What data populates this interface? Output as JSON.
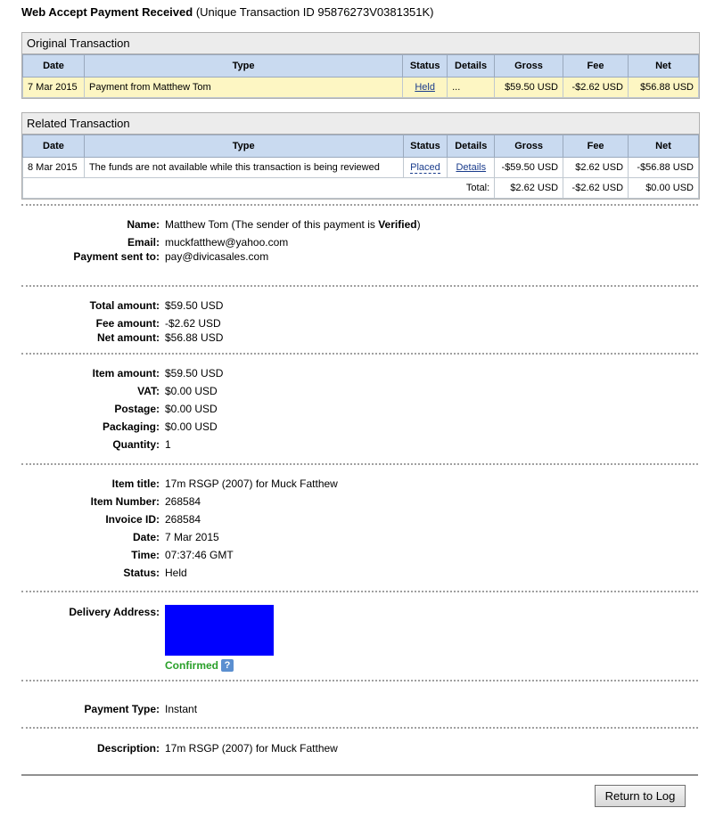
{
  "header": {
    "title_bold": "Web Accept Payment Received",
    "title_rest": "(Unique Transaction ID 95876273V0381351K)"
  },
  "columns": [
    "Date",
    "Type",
    "Status",
    "Details",
    "Gross",
    "Fee",
    "Net"
  ],
  "original": {
    "heading": "Original Transaction",
    "row": {
      "date": "7 Mar 2015",
      "type": "Payment from Matthew Tom",
      "status": "Held",
      "details": "...",
      "gross": "$59.50 USD",
      "fee": "-$2.62 USD",
      "net": "$56.88 USD"
    }
  },
  "related": {
    "heading": "Related Transaction",
    "row": {
      "date": "8 Mar 2015",
      "type": "The funds are not available while this transaction is being reviewed",
      "status": "Placed",
      "details": "Details",
      "gross": "-$59.50 USD",
      "fee": "$2.62 USD",
      "net": "-$56.88 USD"
    },
    "total": {
      "label": "Total:",
      "gross": "$2.62 USD",
      "fee": "-$2.62 USD",
      "net": "$0.00 USD"
    }
  },
  "sender": {
    "name_label": "Name:",
    "name_value": "Matthew Tom (The sender of this payment is ",
    "name_verified": "Verified",
    "name_close": ")",
    "email_label": "Email:",
    "email_value": "muckfatthew@yahoo.com",
    "sent_label": "Payment sent to:",
    "sent_value": "pay@divicasales.com"
  },
  "amounts": {
    "total_label": "Total amount:",
    "total_value": "$59.50 USD",
    "fee_label": "Fee amount:",
    "fee_value": "-$2.62 USD",
    "net_label": "Net amount:",
    "net_value": "$56.88 USD"
  },
  "item": {
    "item_amount_label": "Item amount:",
    "item_amount_value": "$59.50 USD",
    "vat_label": "VAT:",
    "vat_value": "$0.00 USD",
    "postage_label": "Postage:",
    "postage_value": "$0.00 USD",
    "packaging_label": "Packaging:",
    "packaging_value": "$0.00 USD",
    "quantity_label": "Quantity:",
    "quantity_value": "1"
  },
  "details": {
    "title_label": "Item title:",
    "title_value": "17m RSGP (2007) for Muck Fatthew",
    "number_label": "Item Number:",
    "number_value": "268584",
    "invoice_label": "Invoice ID:",
    "invoice_value": "268584",
    "date_label": "Date:",
    "date_value": "7 Mar 2015",
    "time_label": "Time:",
    "time_value": "07:37:46 GMT",
    "status_label": "Status:",
    "status_value": "Held"
  },
  "delivery": {
    "label": "Delivery Address:",
    "confirmed": "Confirmed",
    "help_icon": "?",
    "redaction_color": "#0000ff"
  },
  "payment_type": {
    "label": "Payment Type:",
    "value": "Instant"
  },
  "description": {
    "label": "Description:",
    "value": "17m RSGP (2007) for Muck Fatthew"
  },
  "buttons": {
    "return_label": "Return to Log"
  }
}
